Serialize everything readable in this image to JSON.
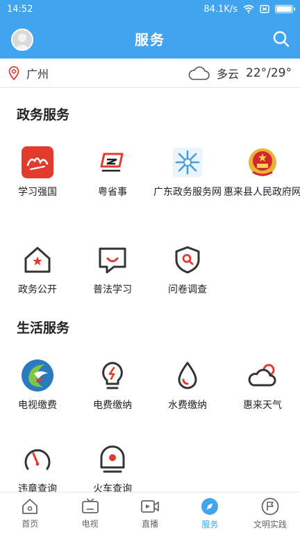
{
  "status": {
    "time": "14:52",
    "speed": "84.1K/s",
    "battery_percent": 100
  },
  "header": {
    "title": "服务"
  },
  "weather": {
    "city": "广州",
    "condition": "多云",
    "temp": "22°/29°"
  },
  "sections": [
    {
      "title": "政务服务",
      "items": [
        {
          "label": "学习强国",
          "icon": "xuexi-qiangguo-logo",
          "color": "#e23b2d"
        },
        {
          "label": "粤省事",
          "icon": "yue-sheng-shi-logo",
          "color": "#e23b2d"
        },
        {
          "label": "广东政务服务网",
          "icon": "guangdong-gov-logo",
          "color": "#4a9ed8"
        },
        {
          "label": "惠来县人民政府网",
          "icon": "national-emblem-icon",
          "color": "#d8262b"
        },
        {
          "label": "政务公开",
          "icon": "house-star-icon",
          "color": "#333"
        },
        {
          "label": "普法学习",
          "icon": "chat-bubble-icon",
          "color": "#333"
        },
        {
          "label": "问卷调查",
          "icon": "shield-search-icon",
          "color": "#333"
        }
      ]
    },
    {
      "title": "生活服务",
      "items": [
        {
          "label": "电视缴费",
          "icon": "tv-payment-logo",
          "color": "#2a7ac0"
        },
        {
          "label": "电费缴纳",
          "icon": "lightbulb-icon",
          "color": "#333"
        },
        {
          "label": "水费缴纳",
          "icon": "water-drop-icon",
          "color": "#333"
        },
        {
          "label": "惠来天气",
          "icon": "cloud-sun-icon",
          "color": "#333"
        },
        {
          "label": "违章查询",
          "icon": "gauge-icon",
          "color": "#333"
        },
        {
          "label": "火车查询",
          "icon": "train-icon",
          "color": "#333"
        }
      ]
    }
  ],
  "tabs": [
    {
      "label": "首页",
      "icon": "home-icon",
      "active": false
    },
    {
      "label": "电视",
      "icon": "tv-icon",
      "active": false
    },
    {
      "label": "直播",
      "icon": "video-icon",
      "active": false
    },
    {
      "label": "服务",
      "icon": "compass-icon",
      "active": true
    },
    {
      "label": "文明实践",
      "icon": "flag-circle-icon",
      "active": false
    }
  ],
  "colors": {
    "primary": "#41a4ee",
    "accent_red": "#e23b2d"
  }
}
